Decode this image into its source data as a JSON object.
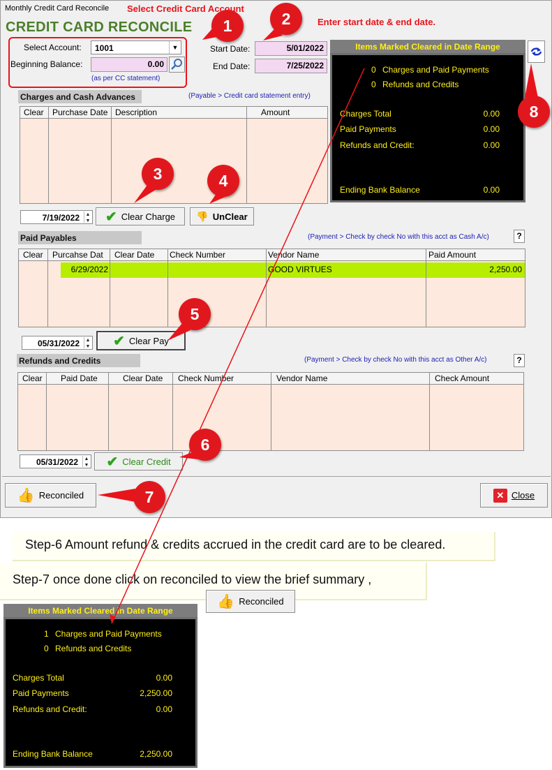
{
  "window": {
    "title": "Monthly Credit Card Reconcile",
    "heading": "CREDIT CARD RECONCILE"
  },
  "annotations": {
    "select_account": "Select Credit Card Account",
    "enter_dates": "Enter start date & end date.",
    "steps": [
      "1",
      "2",
      "3",
      "4",
      "5",
      "6",
      "7",
      "8"
    ]
  },
  "account": {
    "select_label": "Select Account:",
    "select_value": "1001",
    "beginning_label": "Beginning Balance:",
    "beginning_value": "0.00",
    "note": "(as per CC statement)"
  },
  "dates": {
    "start_label": "Start Date:",
    "start_value": "5/01/2022",
    "end_label": "End Date:",
    "end_value": "7/25/2022"
  },
  "charges": {
    "title": "Charges and Cash Advances",
    "hint": "(Payable > Credit card statement entry)",
    "columns": [
      "Clear",
      "Purchase Date",
      "Description",
      "Amount"
    ],
    "date": "7/19/2022",
    "clear_button": "Clear Charge",
    "unclear_button": "UnClear"
  },
  "paid": {
    "title": "Paid Payables",
    "hint": "(Payment > Check by check No with this acct as Cash A/c)",
    "help": "?",
    "columns": [
      "Clear",
      "Purcahse Dat",
      "Clear Date",
      "Check Number",
      "Vendor Name",
      "Paid Amount"
    ],
    "rows": [
      {
        "date": "6/29/2022",
        "vendor": "GOOD VIRTUES",
        "amount": "2,250.00"
      }
    ],
    "date": "05/31/2022",
    "clear_button": "Clear Pay"
  },
  "refunds": {
    "title": "Refunds and Credits",
    "hint": "(Payment > Check by check No with this acct as Other A/c)",
    "help": "?",
    "columns": [
      "Clear",
      "Paid Date",
      "Clear Date",
      "Check Number",
      "Vendor Name",
      "Check Amount"
    ],
    "date": "05/31/2022",
    "clear_button": "Clear Credit"
  },
  "summary": {
    "title": "Items Marked Cleared in Date Range",
    "count_charges": "0",
    "count_charges_label": "Charges and Paid Payments",
    "count_refunds": "0",
    "count_refunds_label": "Refunds and Credits",
    "charges_total_label": "Charges Total",
    "charges_total": "0.00",
    "paid_label": "Paid Payments",
    "paid": "0.00",
    "refunds_label": "Refunds and Credit:",
    "refunds": "0.00",
    "ending_label": "Ending Bank Balance",
    "ending": "0.00"
  },
  "footer": {
    "reconciled_button": "Reconciled",
    "close_button": "Close"
  },
  "notes": {
    "step6": "Step-6 Amount refund & credits accrued in the credit card are to be cleared.",
    "step7": "Step-7  once done click on reconciled to view the brief summary ,"
  },
  "summary_after": {
    "title": "Items Marked Cleared in Date Range",
    "count_charges": "1",
    "count_charges_label": "Charges and Paid Payments",
    "count_refunds": "0",
    "count_refunds_label": "Refunds and Credits",
    "charges_total_label": "Charges Total",
    "charges_total": "0.00",
    "paid_label": "Paid Payments",
    "paid": "2,250.00",
    "refunds_label": "Refunds and Credit:",
    "refunds": "0.00",
    "ending_label": "Ending Bank Balance",
    "ending": "2,250.00"
  },
  "colors": {
    "heading": "#4b7f2a",
    "field_bg": "#f3d8f1",
    "grid_bg": "#fde9dd",
    "selected_row": "#b7ee00",
    "panel_text": "#ffef19",
    "annotation_red": "#e8141b"
  }
}
